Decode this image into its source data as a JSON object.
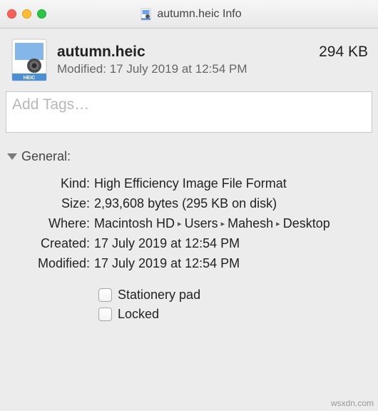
{
  "window": {
    "title": "autumn.heic Info"
  },
  "header": {
    "filename": "autumn.heic",
    "size_display": "294 KB",
    "modified_prefix": "Modified:",
    "modified_value": "17 July 2019 at 12:54 PM",
    "icon_badge": "HEIC"
  },
  "tags": {
    "placeholder": "Add Tags…"
  },
  "general": {
    "section_label": "General:",
    "rows": {
      "kind_label": "Kind:",
      "kind_value": "High Efficiency Image File Format",
      "size_label": "Size:",
      "size_value": "2,93,608 bytes (295 KB on disk)",
      "where_label": "Where:",
      "where_path": [
        "Macintosh HD",
        "Users",
        "Mahesh",
        "Desktop"
      ],
      "created_label": "Created:",
      "created_value": "17 July 2019 at 12:54 PM",
      "modified_label": "Modified:",
      "modified_value": "17 July 2019 at 12:54 PM"
    },
    "checkboxes": {
      "stationery_label": "Stationery pad",
      "stationery_checked": false,
      "locked_label": "Locked",
      "locked_checked": false
    }
  },
  "watermark": "wsxdn.com"
}
